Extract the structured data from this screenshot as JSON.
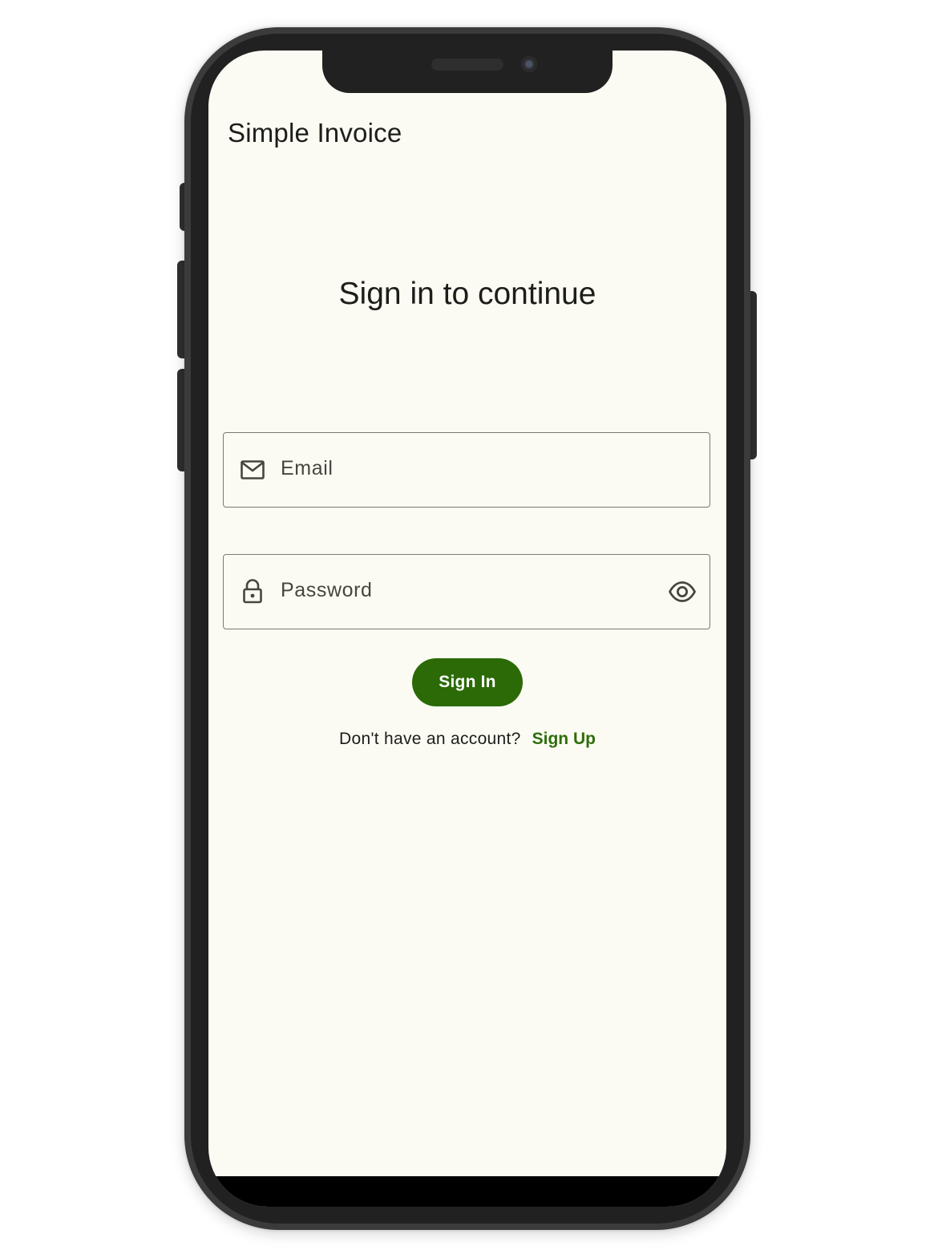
{
  "app_bar": {
    "title": "Simple Invoice"
  },
  "login": {
    "headline": "Sign in to continue",
    "email_field": {
      "label": "Email",
      "icon": "mail-icon"
    },
    "password_field": {
      "label": "Password",
      "icon": "lock-icon",
      "toggle_icon": "eye-icon"
    },
    "sign_in_label": "Sign In",
    "signup_prompt": "Don't have an account?",
    "signup_link": "Sign Up"
  },
  "colors": {
    "background": "#fbfbf3",
    "primary": "#2b6a06",
    "link": "#2e6e0c",
    "text": "#1d1d1b",
    "outline": "#7a7a70"
  }
}
